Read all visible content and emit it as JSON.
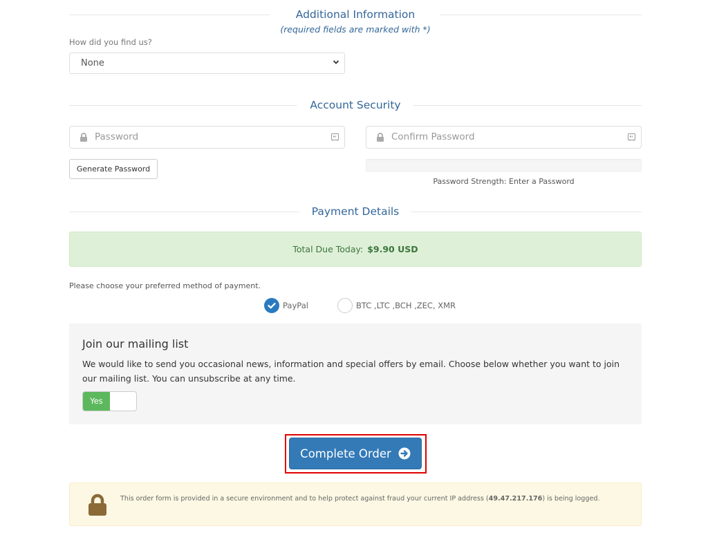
{
  "additional_info": {
    "title": "Additional Information",
    "subtitle": "(required fields are marked with *)",
    "find_us_label": "How did you find us?",
    "find_us_value": "None"
  },
  "account_security": {
    "title": "Account Security",
    "password_placeholder": "Password",
    "confirm_placeholder": "Confirm Password",
    "generate_button": "Generate Password",
    "strength_text": "Password Strength: Enter a Password",
    "strength_percent": 0
  },
  "payment": {
    "title": "Payment Details",
    "total_label": "Total Due Today:",
    "total_value": "$9.90 USD",
    "method_prompt": "Please choose your preferred method of payment.",
    "methods": [
      {
        "label": "PayPal",
        "selected": true
      },
      {
        "label": "BTC ,LTC ,BCH ,ZEC, XMR",
        "selected": false
      }
    ]
  },
  "mailing_list": {
    "title": "Join our mailing list",
    "text": "We would like to send you occasional news, information and special offers by email. Choose below whether you want to join our mailing list. You can unsubscribe at any time.",
    "toggle_label": "Yes",
    "toggle_on": true
  },
  "complete_order": {
    "label": "Complete Order"
  },
  "security_notice": {
    "text_before": "This order form is provided in a secure environment and to help protect against fraud your current IP address (",
    "ip": "49.47.217.176",
    "text_after": ") is being logged."
  },
  "colors": {
    "accent": "#337ab7",
    "heading": "#336699",
    "success_bg": "#dff0d8",
    "toggle_on": "#5cb85c",
    "warning_bg": "#fcf8e3",
    "highlight": "#e00000"
  }
}
